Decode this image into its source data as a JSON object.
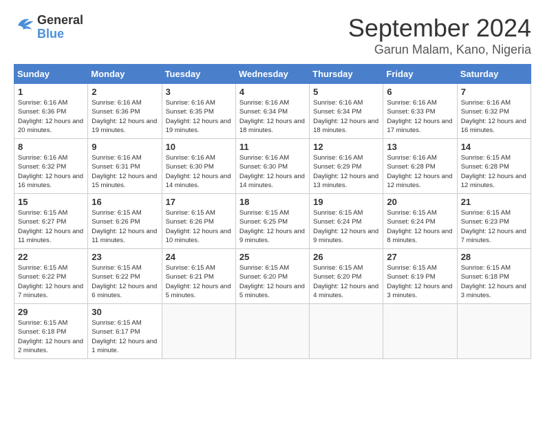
{
  "logo": {
    "line1": "General",
    "line2": "Blue"
  },
  "header": {
    "month": "September 2024",
    "location": "Garun Malam, Kano, Nigeria"
  },
  "columns": [
    "Sunday",
    "Monday",
    "Tuesday",
    "Wednesday",
    "Thursday",
    "Friday",
    "Saturday"
  ],
  "weeks": [
    [
      {
        "day": "1",
        "sunrise": "6:16 AM",
        "sunset": "6:36 PM",
        "daylight": "12 hours and 20 minutes."
      },
      {
        "day": "2",
        "sunrise": "6:16 AM",
        "sunset": "6:36 PM",
        "daylight": "12 hours and 19 minutes."
      },
      {
        "day": "3",
        "sunrise": "6:16 AM",
        "sunset": "6:35 PM",
        "daylight": "12 hours and 19 minutes."
      },
      {
        "day": "4",
        "sunrise": "6:16 AM",
        "sunset": "6:34 PM",
        "daylight": "12 hours and 18 minutes."
      },
      {
        "day": "5",
        "sunrise": "6:16 AM",
        "sunset": "6:34 PM",
        "daylight": "12 hours and 18 minutes."
      },
      {
        "day": "6",
        "sunrise": "6:16 AM",
        "sunset": "6:33 PM",
        "daylight": "12 hours and 17 minutes."
      },
      {
        "day": "7",
        "sunrise": "6:16 AM",
        "sunset": "6:32 PM",
        "daylight": "12 hours and 16 minutes."
      }
    ],
    [
      {
        "day": "8",
        "sunrise": "6:16 AM",
        "sunset": "6:32 PM",
        "daylight": "12 hours and 16 minutes."
      },
      {
        "day": "9",
        "sunrise": "6:16 AM",
        "sunset": "6:31 PM",
        "daylight": "12 hours and 15 minutes."
      },
      {
        "day": "10",
        "sunrise": "6:16 AM",
        "sunset": "6:30 PM",
        "daylight": "12 hours and 14 minutes."
      },
      {
        "day": "11",
        "sunrise": "6:16 AM",
        "sunset": "6:30 PM",
        "daylight": "12 hours and 14 minutes."
      },
      {
        "day": "12",
        "sunrise": "6:16 AM",
        "sunset": "6:29 PM",
        "daylight": "12 hours and 13 minutes."
      },
      {
        "day": "13",
        "sunrise": "6:16 AM",
        "sunset": "6:28 PM",
        "daylight": "12 hours and 12 minutes."
      },
      {
        "day": "14",
        "sunrise": "6:15 AM",
        "sunset": "6:28 PM",
        "daylight": "12 hours and 12 minutes."
      }
    ],
    [
      {
        "day": "15",
        "sunrise": "6:15 AM",
        "sunset": "6:27 PM",
        "daylight": "12 hours and 11 minutes."
      },
      {
        "day": "16",
        "sunrise": "6:15 AM",
        "sunset": "6:26 PM",
        "daylight": "12 hours and 11 minutes."
      },
      {
        "day": "17",
        "sunrise": "6:15 AM",
        "sunset": "6:26 PM",
        "daylight": "12 hours and 10 minutes."
      },
      {
        "day": "18",
        "sunrise": "6:15 AM",
        "sunset": "6:25 PM",
        "daylight": "12 hours and 9 minutes."
      },
      {
        "day": "19",
        "sunrise": "6:15 AM",
        "sunset": "6:24 PM",
        "daylight": "12 hours and 9 minutes."
      },
      {
        "day": "20",
        "sunrise": "6:15 AM",
        "sunset": "6:24 PM",
        "daylight": "12 hours and 8 minutes."
      },
      {
        "day": "21",
        "sunrise": "6:15 AM",
        "sunset": "6:23 PM",
        "daylight": "12 hours and 7 minutes."
      }
    ],
    [
      {
        "day": "22",
        "sunrise": "6:15 AM",
        "sunset": "6:22 PM",
        "daylight": "12 hours and 7 minutes."
      },
      {
        "day": "23",
        "sunrise": "6:15 AM",
        "sunset": "6:22 PM",
        "daylight": "12 hours and 6 minutes."
      },
      {
        "day": "24",
        "sunrise": "6:15 AM",
        "sunset": "6:21 PM",
        "daylight": "12 hours and 5 minutes."
      },
      {
        "day": "25",
        "sunrise": "6:15 AM",
        "sunset": "6:20 PM",
        "daylight": "12 hours and 5 minutes."
      },
      {
        "day": "26",
        "sunrise": "6:15 AM",
        "sunset": "6:20 PM",
        "daylight": "12 hours and 4 minutes."
      },
      {
        "day": "27",
        "sunrise": "6:15 AM",
        "sunset": "6:19 PM",
        "daylight": "12 hours and 3 minutes."
      },
      {
        "day": "28",
        "sunrise": "6:15 AM",
        "sunset": "6:18 PM",
        "daylight": "12 hours and 3 minutes."
      }
    ],
    [
      {
        "day": "29",
        "sunrise": "6:15 AM",
        "sunset": "6:18 PM",
        "daylight": "12 hours and 2 minutes."
      },
      {
        "day": "30",
        "sunrise": "6:15 AM",
        "sunset": "6:17 PM",
        "daylight": "12 hours and 1 minute."
      },
      null,
      null,
      null,
      null,
      null
    ]
  ]
}
